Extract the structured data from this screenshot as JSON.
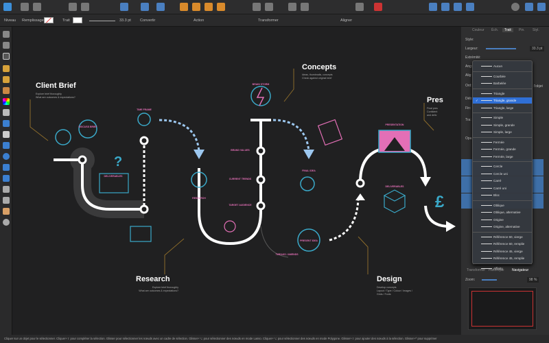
{
  "context_bar": {
    "level": "Niveau",
    "fill": "Remplissage",
    "stroke": "Trait",
    "stroke_width": "33.3 pt",
    "convert": "Convertir",
    "action": "Action",
    "transform": "Transformer",
    "align": "Aligner"
  },
  "canvas": {
    "sections": [
      {
        "title": "Client Brief",
        "lines": [
          "Explore brief thoroughly",
          "What are outcomes & expectations?"
        ]
      },
      {
        "title": "Concepts",
        "lines": [
          "Ideas, thumbnails, concepts",
          "Check against original brief"
        ]
      },
      {
        "title": "Research",
        "lines": [
          "Explore brief thoroughly",
          "What are outcomes & expectations?"
        ]
      },
      {
        "title": "Design",
        "lines": [
          "Develop concepts",
          "Layout / Type / Colour / Images /",
          "Grids / Fonts"
        ]
      },
      {
        "title": "Pres",
        "lines": [
          "Final pres",
          "Confident",
          "and deliv"
        ]
      }
    ],
    "labels": {
      "discuss_brief": "DISCUSS BRIEF",
      "time_frame": "TIME FRAME",
      "brain_storm": "BRAIN STORM",
      "deliverables": "DELIVERABLES",
      "brand_values": "BRAND VALUES",
      "current_trends": "CURRENT TRENDS",
      "target_audience": "TARGET AUDIENCE",
      "research": "RESEARCH",
      "final_idea": "FINAL IDEA",
      "present_idea": "PRESENT IDEA",
      "tweaks": "TWEAKS / AMENDS",
      "presentation": "PRESENTATION",
      "deliverables2": "DELIVERABLES"
    },
    "colors": {
      "path": "#ffffff",
      "cyan": "#3aa9c9",
      "pink": "#e36fb6",
      "dashed": "#9cc7ef",
      "leader": "#8a6a2a"
    }
  },
  "panel": {
    "tabs": [
      "Couleur",
      "Éch.",
      "Trait",
      "Pin.",
      "Styl."
    ],
    "active_tab": "Trait",
    "style_label": "Style:",
    "width_label": "Largeur:",
    "width_value": "33.3 pt",
    "cap_label": "Extrémité:",
    "angle_label": "Ang:",
    "align_label": "Alig:",
    "order_label": "Ord:",
    "object_label": "l'objet",
    "start_label": "Déb:",
    "end_label": "Fin:",
    "trans_label": "Tra:",
    "layers_label": "Opa:",
    "bottom_tabs": [
      "Transformer",
      "Historique",
      "Navigateur"
    ],
    "zoom_label": "Zoom:",
    "zoom_value": "98 %"
  },
  "menu": {
    "groups": [
      [
        "Aucun"
      ],
      [
        "Courbée",
        "Barbelée"
      ],
      [
        "Triangle",
        "Triangle, grande",
        "Triangle, large"
      ],
      [
        "Simple",
        "Simple, grande",
        "Simple, large"
      ],
      [
        "Fermée",
        "Fermée, grande",
        "Fermée, large"
      ],
      [
        "Cercle",
        "Cercle uni",
        "Carré",
        "Carré uni",
        "Bloc"
      ],
      [
        "Oblique",
        "Oblique, alternative",
        "Origine",
        "Origine, alternative"
      ],
      [
        "Référence 60, vierge",
        "Référence 60, remplie",
        "Référence 45, vierge",
        "Référence 45, remplie"
      ],
      [
        "Affinity"
      ]
    ],
    "selected": "Triangle, grande"
  },
  "status": "Cliquer sur un objet pour le sélectionner. Cliquer+⇧ pour compléter la sélection. Glisser pour sélectionner les nœuds avec un cadre de sélection. Glisser+⌥ pour sélectionner des nœuds en mode Lasso. Cliquer+⌥ pour sélectionner des nœuds en mode Polygone. Glisser+⇧ pour ajouter des nœuds à la sélection. Glisser+^ pour supprimer"
}
